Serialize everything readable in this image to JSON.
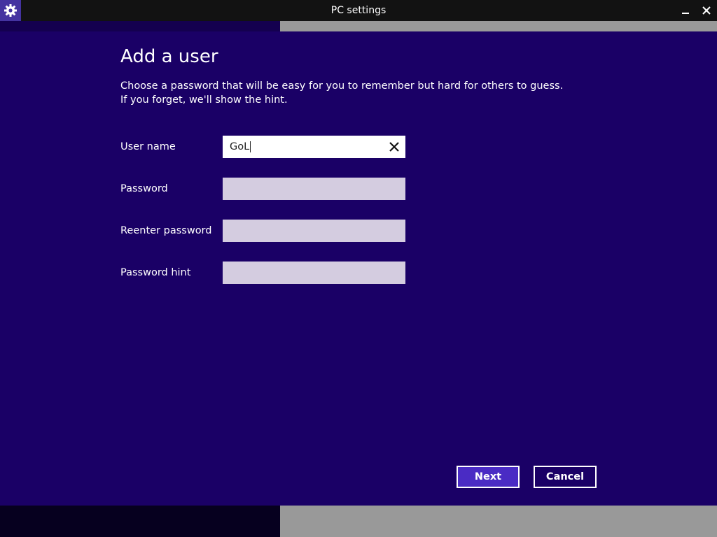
{
  "window": {
    "title": "PC settings",
    "app_icon": "gear-icon",
    "minimize_icon": "minimize-icon",
    "close_icon": "close-icon"
  },
  "colors": {
    "background": "#1a0066",
    "titlebar": "#121212",
    "input_inactive": "#d4cce0",
    "input_active": "#ffffff",
    "next_button": "#4a2bc4"
  },
  "page": {
    "title": "Add a user",
    "description": "Choose a password that will be easy for you to remember but hard for others to guess. If you forget, we'll show the hint."
  },
  "form": {
    "username": {
      "label": "User name",
      "value": "GoL",
      "clear_icon": "close-icon"
    },
    "password": {
      "label": "Password",
      "value": ""
    },
    "reenter_password": {
      "label": "Reenter password",
      "value": ""
    },
    "password_hint": {
      "label": "Password hint",
      "value": ""
    }
  },
  "buttons": {
    "next": "Next",
    "cancel": "Cancel"
  }
}
